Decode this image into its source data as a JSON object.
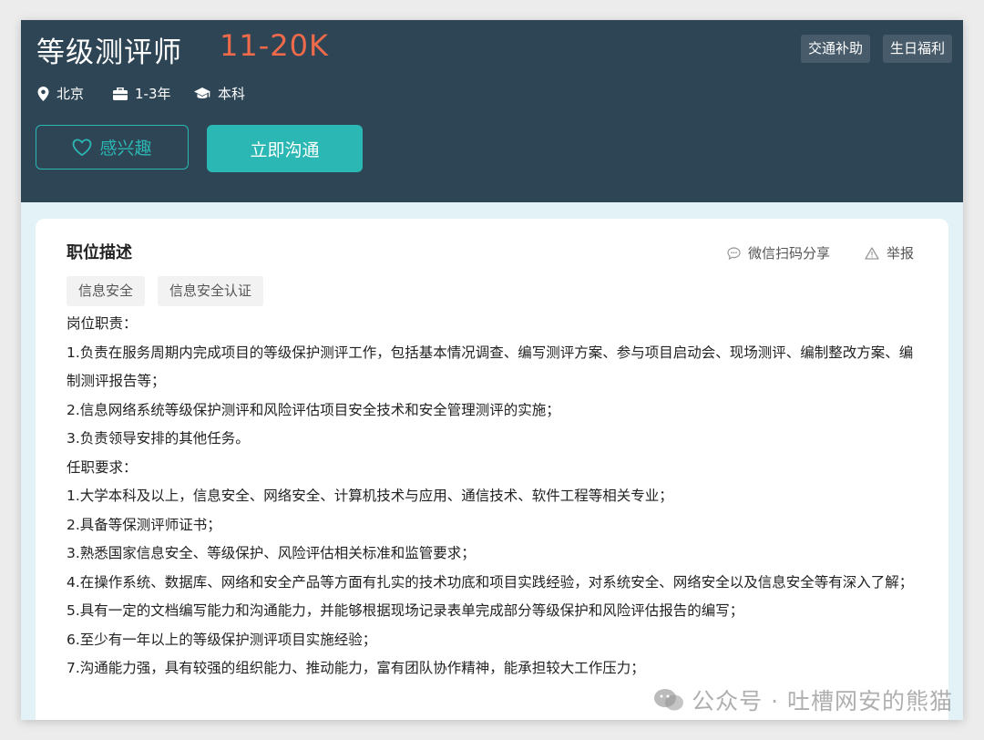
{
  "job": {
    "title": "等级测评师",
    "salary": "11-20K",
    "benefits": [
      "交通补助",
      "生日福利"
    ],
    "location": "北京",
    "experience": "1-3年",
    "education": "本科"
  },
  "actions": {
    "interest_label": "感兴趣",
    "chat_label": "立即沟通"
  },
  "description": {
    "section_title": "职位描述",
    "share_label": "微信扫码分享",
    "report_label": "举报",
    "tags": [
      "信息安全",
      "信息安全认证"
    ],
    "lines": [
      "岗位职责：",
      "1.负责在服务周期内完成项目的等级保护测评工作，包括基本情况调查、编写测评方案、参与项目启动会、现场测评、编制整改方案、编制测评报告等；",
      "2.信息网络系统等级保护测评和风险评估项目安全技术和安全管理测评的实施；",
      "3.负责领导安排的其他任务。",
      "任职要求：",
      "1.大学本科及以上，信息安全、网络安全、计算机技术与应用、通信技术、软件工程等相关专业；",
      "2.具备等保测评师证书；",
      "3.熟悉国家信息安全、等级保护、风险评估相关标准和监管要求；",
      "4.在操作系统、数据库、网络和安全产品等方面有扎实的技术功底和项目实践经验，对系统安全、网络安全以及信息安全等有深入了解；",
      "5.具有一定的文档编写能力和沟通能力，并能够根据现场记录表单完成部分等级保护和风险评估报告的编写；",
      "6.至少有一年以上的等级保护测评项目实施经验；",
      "7.沟通能力强，具有较强的组织能力、推动能力，富有团队协作精神，能承担较大工作压力；"
    ]
  },
  "watermark": "公众号 · 吐槽网安的熊猫",
  "colors": {
    "header_bg": "#2e4556",
    "accent": "#2bb7b3",
    "salary": "#ef6a4a",
    "page_bg": "#e2f2f7"
  }
}
